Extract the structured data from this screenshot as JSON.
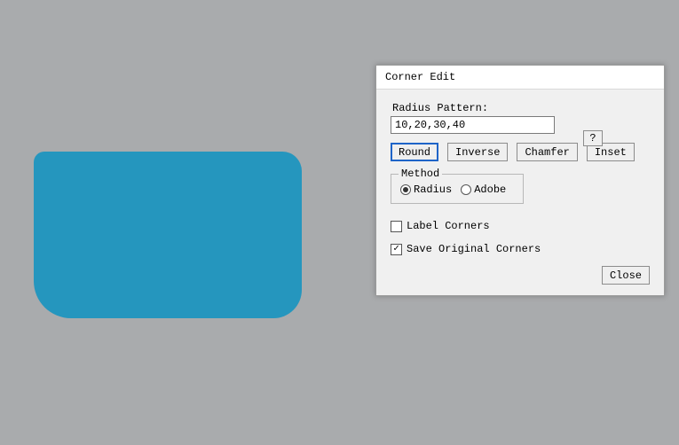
{
  "preview": {
    "fill": "#2596be",
    "radii": {
      "tl": 12,
      "tr": 22,
      "br": 32,
      "bl": 42
    }
  },
  "dialog": {
    "title": "Corner Edit",
    "radius_pattern_label": "Radius Pattern:",
    "radius_pattern_value": "10,20,30,40",
    "help_label": "?",
    "buttons": {
      "round": "Round",
      "inverse": "Inverse",
      "chamfer": "Chamfer",
      "inset": "Inset",
      "selected": "round"
    },
    "method": {
      "group_label": "Method",
      "radius_label": "Radius",
      "adobe_label": "Adobe",
      "selected": "radius"
    },
    "label_corners": {
      "label": "Label Corners",
      "checked": false
    },
    "save_original": {
      "label": "Save Original Corners",
      "checked": true
    },
    "close_label": "Close"
  }
}
